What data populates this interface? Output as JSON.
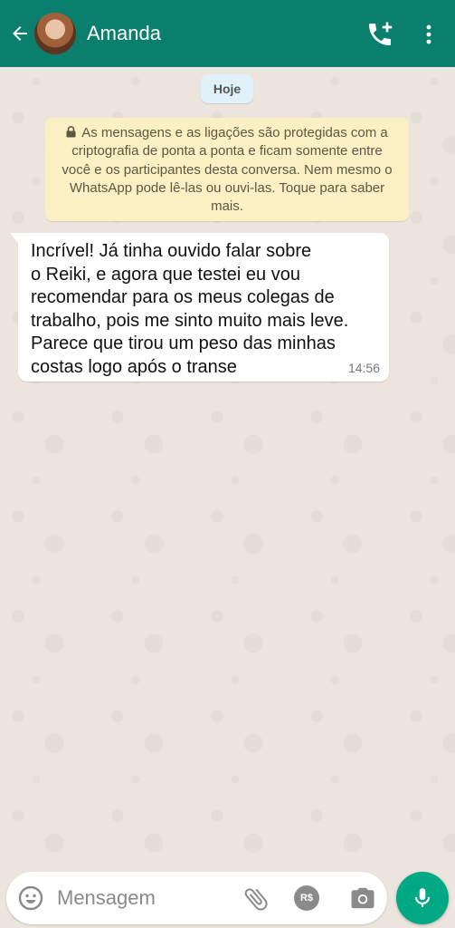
{
  "header": {
    "contact_name": "Amanda",
    "background_color": "#0b7f6e",
    "icons": [
      "back-arrow-icon",
      "add-call-icon",
      "more-vert-icon"
    ]
  },
  "chat": {
    "date_label": "Hoje",
    "encryption_notice": "As mensagens e as ligações são protegidas com a criptografia de ponta a ponta e ficam somente entre você e os participantes desta conversa. Nem mesmo o WhatsApp pode lê-las ou ouvi-las. Toque para saber mais.",
    "messages": [
      {
        "text": "Incrível! Já tinha ouvido falar sobre\no Reiki, e agora que testei eu vou\nrecomendar para os meus colegas de\ntrabalho, pois me sinto muito mais leve.\nParece que tirou um peso das minhas\ncostas logo após o transe",
        "time": "14:56",
        "direction": "incoming"
      }
    ]
  },
  "composer": {
    "placeholder": "Mensagem",
    "pay_label": "R$",
    "icons": [
      "emoji-icon",
      "attach-icon",
      "payment-icon",
      "camera-icon",
      "mic-icon"
    ],
    "mic_color": "#00a884"
  }
}
